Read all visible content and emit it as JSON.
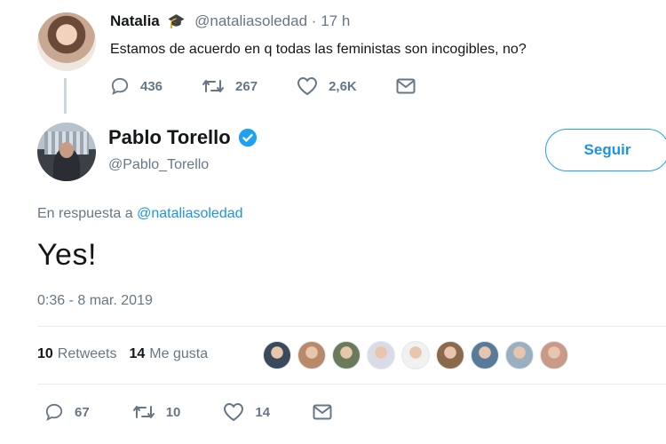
{
  "parent_tweet": {
    "name": "Natalia",
    "badge": "🎓",
    "handle": "@nataliasoledad",
    "separator": "·",
    "time": "17 h",
    "text": "Estamos de acuerdo en q todas las feministas son incogibles, no?",
    "replies": "436",
    "retweets": "267",
    "likes": "2,6K"
  },
  "author": {
    "name": "Pablo Torello",
    "handle": "@Pablo_Torello",
    "follow_label": "Seguir"
  },
  "tweet": {
    "reply_prefix": "En respuesta a",
    "reply_handle": "@nataliasoledad",
    "text": "Yes!",
    "timestamp": "0:36 - 8 mar. 2019"
  },
  "stats": {
    "retweets_count": "10",
    "retweets_label": "Retweets",
    "likes_count": "14",
    "likes_label": "Me gusta"
  },
  "liker_avatars": [
    {
      "color": "#3b4a5a"
    },
    {
      "color": "#b98a6a"
    },
    {
      "color": "#6a7b5a"
    },
    {
      "color": "#d9dbe6"
    },
    {
      "color": "#f1f1f1"
    },
    {
      "color": "#8a6a4a"
    },
    {
      "color": "#5a7a9a"
    },
    {
      "color": "#9ab0c0"
    },
    {
      "color": "#c99a86"
    }
  ],
  "actions": {
    "replies": "67",
    "retweets": "10",
    "likes": "14"
  },
  "colors": {
    "accent": "#1da1f2",
    "muted": "#657786",
    "text": "#14171a"
  }
}
